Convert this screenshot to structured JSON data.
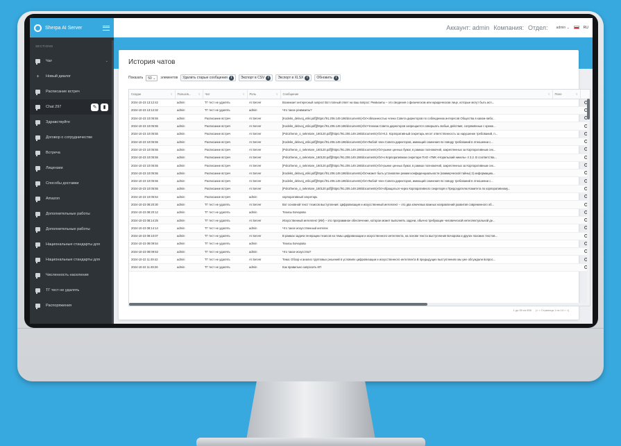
{
  "app": {
    "name": "Sherpa AI Server"
  },
  "sidebar": {
    "sections_label": "SECTIONS",
    "items": [
      {
        "label": "Чат",
        "icon": "chat-icon"
      },
      {
        "label": "Новый диалог",
        "icon": "plus-icon"
      },
      {
        "label": "Расписание встреч",
        "icon": "chat-icon"
      },
      {
        "label": "Chat 297",
        "icon": "chat-icon"
      },
      {
        "label": "Здравствуйте",
        "icon": "chat-icon"
      },
      {
        "label": "Договор о сотрудничестве",
        "icon": "chat-icon"
      },
      {
        "label": "Встреча",
        "icon": "chat-icon"
      },
      {
        "label": "Лицензии",
        "icon": "chat-icon"
      },
      {
        "label": "Способы доставки",
        "icon": "chat-icon"
      },
      {
        "label": "Amazon",
        "icon": "chat-icon"
      },
      {
        "label": "Дополнительные работы",
        "icon": "chat-icon"
      },
      {
        "label": "Дополнительные работы",
        "icon": "chat-icon"
      },
      {
        "label": "Национальные стандарты для",
        "icon": "chat-icon"
      },
      {
        "label": "Национальные стандарты для",
        "icon": "chat-icon"
      },
      {
        "label": "Численность населения",
        "icon": "chat-icon"
      },
      {
        "label": "ТГ тест не удалять",
        "icon": "chat-icon"
      },
      {
        "label": "Распоряжения",
        "icon": "chat-icon"
      }
    ]
  },
  "topbar": {
    "account_label": "Аккаунт: admin",
    "company_label": "Компания:",
    "department_label": "Отдел:",
    "user": "admin",
    "language": "RU"
  },
  "page": {
    "title": "История чатов"
  },
  "toolbar": {
    "show_label": "Показать",
    "page_size": "50",
    "elements_label": "элементов",
    "delete_old": "Удалить старые сообщения",
    "export_csv": "Экспорт в CSV",
    "export_xlsx": "Экспорт в XLSX",
    "refresh": "Обновить"
  },
  "table": {
    "columns": [
      "Создан",
      "Пользов...",
      "Чат",
      "Роль",
      "Сообщение",
      "Поле"
    ],
    "rows": [
      [
        "2024-10-23 13:12:42",
        "admin",
        "ТГ тест не удалять",
        "AI Server",
        "Возникает интересный запрос! Вот полный ответ на ваш вопрос: Реквизиты – это сведения о физическом или юридическом лице, которые могут быть исп..."
      ],
      [
        "2024-10-23 13:12:32",
        "admin",
        "ТГ тест не удалять",
        "admin",
        "Что такое реквизиты?"
      ],
      [
        "2024-10-23 10:05:55",
        "admin",
        "Расписание встреч",
        "AI Server",
        "[Kodeks_delovoj_etiki.pdf](https://91.206.149.186/documents)<br>обязанностью члена Совета директоров по соблюдению интересов Общества в каком-либо..."
      ],
      [
        "2024-10-23 10:05:55",
        "admin",
        "Расписание встреч",
        "AI Server",
        "[Kodeks_delovoj_etiki.pdf](https://91.206.149.186/documents)<br>Членам Совета директоров запрещается совершать любые действия, сопряжённые с креже..."
      ],
      [
        "2024-10-23 10:05:55",
        "admin",
        "Расписание встреч",
        "AI Server",
        "[Polozhenie_o_sekretare_160120.pdf](https://91.206.149.186/documents)<br>8.2. Корпоративный секретарь несет ответственность за нарушение требований, п..."
      ],
      [
        "2024-10-23 10:05:55",
        "admin",
        "Расписание встреч",
        "AI Server",
        "[Kodeks_delovoj_etiki.pdf](https://91.206.149.186/documents)<br>Любой член Совета директоров, имеющий сомнения по поводу требований в отношении с..."
      ],
      [
        "2024-10-23 10:05:55",
        "admin",
        "Расписание встреч",
        "AI Server",
        "[Polozhenie_o_sekretare_160120.pdf](https://91.206.149.186/documents)<br>рынке ценных бумаг, в рамках полномочий, закрепленных за Корпоративным сек..."
      ],
      [
        "2024-10-23 10:05:55",
        "admin",
        "Расписание встреч",
        "AI Server",
        "[Polozhenie_o_sekretare_160120.pdf](https://91.206.149.186/documents)<br>о Корпоративном секретаре ПАО «ГМК «Норильский никель» 4 3.2. В соответства..."
      ],
      [
        "2024-10-23 10:05:55",
        "admin",
        "Расписание встреч",
        "AI Server",
        "[Polozhenie_o_sekretare_160120.pdf](https://91.206.149.186/documents)<br>рынке ценных бумаг, в рамках полномочий, закрепленных за Корпоративным сек..."
      ],
      [
        "2024-10-23 10:05:55",
        "admin",
        "Расписание встреч",
        "AI Server",
        "[Kodeks_delovoj_etiki.pdf](https://91.206.149.186/documents)<br>может быть установлен режим конфиденциальности (коммерческой тайны) 2) информацию..."
      ],
      [
        "2024-10-23 10:05:55",
        "admin",
        "Расписание встреч",
        "AI Server",
        "[Kodeks_delovoj_etiki.pdf](https://91.206.149.186/documents)<br>Любой член Совета директоров, имеющий сомнения по поводу требований в отношении с..."
      ],
      [
        "2024-10-23 10:05:55",
        "admin",
        "Расписание встреч",
        "AI Server",
        "[Polozhenie_o_sekretare_160120.pdf](https://91.206.149.186/documents)<br>обращаться через Корпоративного секретаря к Председателю Комитета по корпоративному..."
      ],
      [
        "2024-10-23 10:05:54",
        "admin",
        "Расписание встреч",
        "admin",
        "корпоративный секретарь"
      ],
      [
        "2024-10-23 08:20:30",
        "admin",
        "ТГ тест не удалять",
        "AI Server",
        "Вот основной текст тезисов выступления: Цифровизация и искусственный интеллект – это два ключевых важных направлений развития современного об..."
      ],
      [
        "2024-10-23 08:20:12",
        "admin",
        "ТГ тест не удалять",
        "admin",
        "Тезисы Бочарова"
      ],
      [
        "2024-10-23 08:14:25",
        "admin",
        "ТГ тест не удалять",
        "AI Server",
        "Искусственный интеллект (ИИ) – это программное обеспечение, которое может выполнять задачи, обычно требующие человеческой интеллектуальной де..."
      ],
      [
        "2024-10-23 08:14:14",
        "admin",
        "ТГ тест не удалять",
        "admin",
        "Что такое искусственный интелек"
      ],
      [
        "2024-10-23 08:10:07",
        "admin",
        "ТГ тест не удалять",
        "AI Server",
        "В рамках задачи генерации тезисов на темы цифровизации и искусственного интеллекта, на основе текста выступления Бочарова и других похожих текстов..."
      ],
      [
        "2024-10-23 08:09:54",
        "admin",
        "ТГ тест не удалять",
        "admin",
        "Тезисы Бочарова"
      ],
      [
        "2024-10-23 08:09:53",
        "admin",
        "ТГ тест не удалять",
        "admin",
        "Что такое искусство?"
      ],
      [
        "2024-10-22 11:49:42",
        "admin",
        "ТГ тест не удалять",
        "AI Server",
        "Тема: Обзор и анализ трупповых решений в условиях цифровизации и искусственного интеллекта В предыдущих выступлениях мы уже обсуждали вопрос..."
      ],
      [
        "2024-10-22 11:49:26",
        "admin",
        "ТГ тест не удалять",
        "admin",
        "Как правильно запросить КП"
      ]
    ]
  },
  "pager": {
    "summary": "1 до 50 из 656",
    "nav": "|< < Страница 1 из 14 > >|"
  }
}
